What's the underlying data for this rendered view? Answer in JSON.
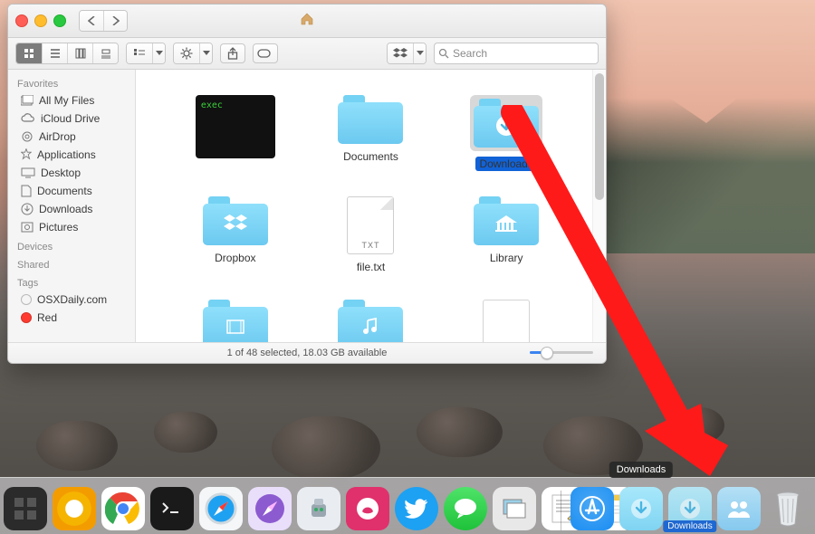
{
  "finder": {
    "title_icon": "home-icon",
    "view_modes": [
      "icon",
      "list",
      "column",
      "coverflow"
    ],
    "search_placeholder": "Search",
    "sidebar": {
      "sections": [
        {
          "header": "Favorites",
          "items": [
            {
              "icon": "all-my-files-icon",
              "label": "All My Files"
            },
            {
              "icon": "cloud-icon",
              "label": "iCloud Drive"
            },
            {
              "icon": "airdrop-icon",
              "label": "AirDrop"
            },
            {
              "icon": "applications-icon",
              "label": "Applications"
            },
            {
              "icon": "desktop-icon",
              "label": "Desktop"
            },
            {
              "icon": "documents-icon",
              "label": "Documents"
            },
            {
              "icon": "downloads-icon",
              "label": "Downloads"
            },
            {
              "icon": "pictures-icon",
              "label": "Pictures"
            }
          ]
        },
        {
          "header": "Devices",
          "items": []
        },
        {
          "header": "Shared",
          "items": []
        },
        {
          "header": "Tags",
          "items": [
            {
              "tag_color": "#ffffff",
              "tag_border": "#b9b9b9",
              "label": "OSXDaily.com"
            },
            {
              "tag_color": "#ff3b30",
              "tag_border": "#d63027",
              "label": "Red"
            }
          ]
        }
      ]
    },
    "items": [
      {
        "kind": "terminal",
        "exec_label": "exec",
        "label": "",
        "selected": false
      },
      {
        "kind": "folder",
        "label": "Documents",
        "glyph": "",
        "selected": false
      },
      {
        "kind": "folder",
        "label": "Downloads",
        "glyph": "download",
        "selected": true
      },
      {
        "kind": "folder",
        "label": "Dropbox",
        "glyph": "dropbox",
        "selected": false
      },
      {
        "kind": "txt",
        "label": "file.txt",
        "ext": "TXT",
        "selected": false
      },
      {
        "kind": "folder",
        "label": "Library",
        "glyph": "library",
        "selected": false
      },
      {
        "kind": "folder",
        "label": "",
        "glyph": "movies",
        "selected": false
      },
      {
        "kind": "folder",
        "label": "",
        "glyph": "music",
        "selected": false
      },
      {
        "kind": "doc",
        "label": "",
        "selected": false
      }
    ],
    "status": "1 of 48 selected, 18.03 GB available"
  },
  "dock": {
    "left": [
      {
        "name": "mission-control",
        "bg": "#2b2b2b"
      },
      {
        "name": "chrome-canary",
        "bg": "#f5b400"
      },
      {
        "name": "chrome",
        "bg": "#ffffff"
      },
      {
        "name": "terminal",
        "bg": "#1a1a1a"
      },
      {
        "name": "safari",
        "bg": "#f4f6f8"
      },
      {
        "name": "safari-preview",
        "bg": "#8d5bd0"
      },
      {
        "name": "automator",
        "bg": "#e9edf2"
      },
      {
        "name": "skitch",
        "bg": "#e0316c"
      },
      {
        "name": "twitter",
        "bg": "#1da1f2"
      },
      {
        "name": "messages",
        "bg": "#1fc23a"
      },
      {
        "name": "preview",
        "bg": "#e8e8e8"
      },
      {
        "name": "textedit",
        "bg": "#ffffff"
      },
      {
        "name": "notes",
        "bg": "#ffffff"
      }
    ],
    "right": [
      {
        "name": "app-store",
        "bg": "#1b8df2"
      },
      {
        "name": "downloads-stack",
        "bg": "#8fe0fb",
        "tooltip": "Downloads"
      },
      {
        "name": "drag-downloads",
        "bg": "#8fe0fb",
        "drag_label": "Downloads"
      },
      {
        "name": "shared",
        "bg": "#86c9ef"
      },
      {
        "name": "trash",
        "bg": "transparent"
      }
    ]
  },
  "colors": {
    "accent": "#1162d6",
    "folder": "#74d2f4"
  }
}
